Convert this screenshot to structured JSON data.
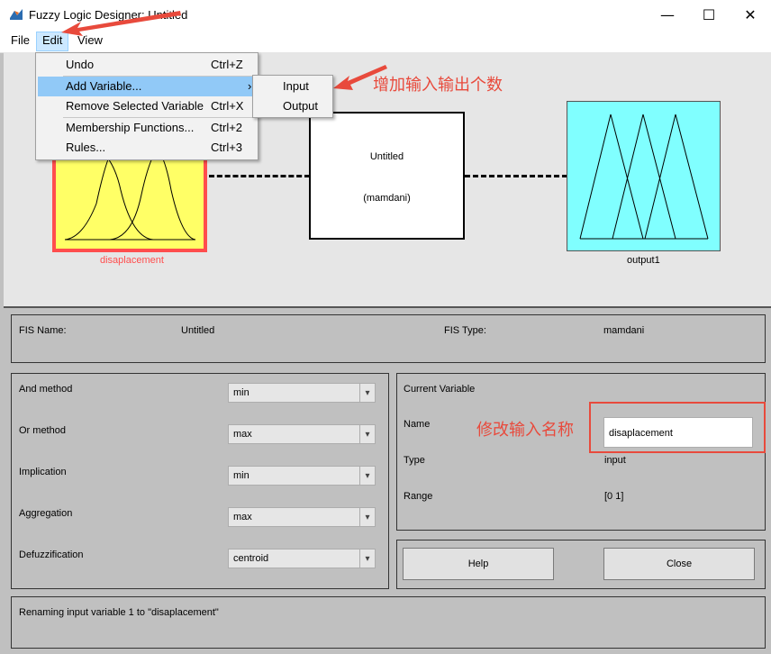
{
  "window": {
    "title": "Fuzzy Logic Designer: Untitled",
    "minimize": "—",
    "maximize": "☐",
    "close": "✕"
  },
  "menu": {
    "file": "File",
    "edit": "Edit",
    "view": "View"
  },
  "edit_menu": {
    "undo": "Undo",
    "undo_shortcut": "Ctrl+Z",
    "add_variable": "Add Variable...",
    "remove_variable": "Remove Selected Variable",
    "remove_shortcut": "Ctrl+X",
    "membership": "Membership Functions...",
    "membership_shortcut": "Ctrl+2",
    "rules": "Rules...",
    "rules_shortcut": "Ctrl+3",
    "submenu_arrow": "›"
  },
  "add_variable_submenu": {
    "input": "Input",
    "output": "Output"
  },
  "diagram": {
    "input_label": "disaplacement",
    "system_name": "Untitled",
    "system_type": "(mamdani)",
    "output_label": "output1"
  },
  "fis_info": {
    "name_label": "FIS Name:",
    "name_value": "Untitled",
    "type_label": "FIS Type:",
    "type_value": "mamdani"
  },
  "methods": {
    "and_label": "And method",
    "and_value": "min",
    "or_label": "Or method",
    "or_value": "max",
    "implication_label": "Implication",
    "implication_value": "min",
    "aggregation_label": "Aggregation",
    "aggregation_value": "max",
    "defuzz_label": "Defuzzification",
    "defuzz_value": "centroid"
  },
  "current_variable": {
    "header": "Current Variable",
    "name_label": "Name",
    "name_value": "disaplacement",
    "type_label": "Type",
    "type_value": "input",
    "range_label": "Range",
    "range_value": "[0 1]"
  },
  "buttons": {
    "help": "Help",
    "close": "Close"
  },
  "status": "Renaming input variable 1 to \"disaplacement\"",
  "annotations": {
    "add_io": "增加输入输出个数",
    "rename_input": "修改输入名称"
  },
  "colors": {
    "input_fill": "#ffff66",
    "input_selected_border": "#ff4d4d",
    "output_fill": "#80ffff",
    "annotation": "#e84a3c"
  }
}
